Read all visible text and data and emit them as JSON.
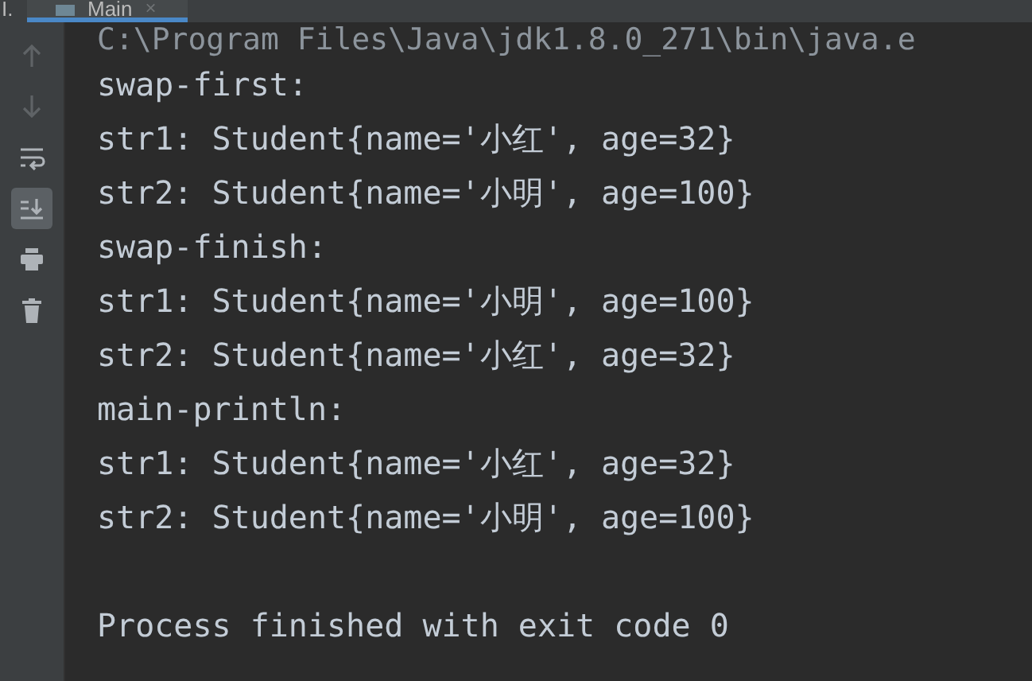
{
  "tab_bar": {
    "left_fragment": "I.",
    "tabs": [
      {
        "label": "Main",
        "close": "×",
        "selected": true
      }
    ]
  },
  "toolbar": [
    {
      "kind": "up",
      "disabled": true,
      "selected": false
    },
    {
      "kind": "down",
      "disabled": true,
      "selected": false
    },
    {
      "kind": "wrap",
      "disabled": false,
      "selected": false
    },
    {
      "kind": "scroll-end",
      "disabled": false,
      "selected": true
    },
    {
      "kind": "print",
      "disabled": false,
      "selected": false
    },
    {
      "kind": "trash",
      "disabled": false,
      "selected": false
    }
  ],
  "console": {
    "command": "C:\\Program Files\\Java\\jdk1.8.0_271\\bin\\java.e",
    "lines": [
      "swap-first:",
      "str1: Student{name='小红', age=32}",
      "str2: Student{name='小明', age=100}",
      "swap-finish:",
      "str1: Student{name='小明', age=100}",
      "str2: Student{name='小红', age=32}",
      "main-println:",
      "str1: Student{name='小红', age=32}",
      "str2: Student{name='小明', age=100}"
    ],
    "exit_message": "Process finished with exit code 0"
  }
}
